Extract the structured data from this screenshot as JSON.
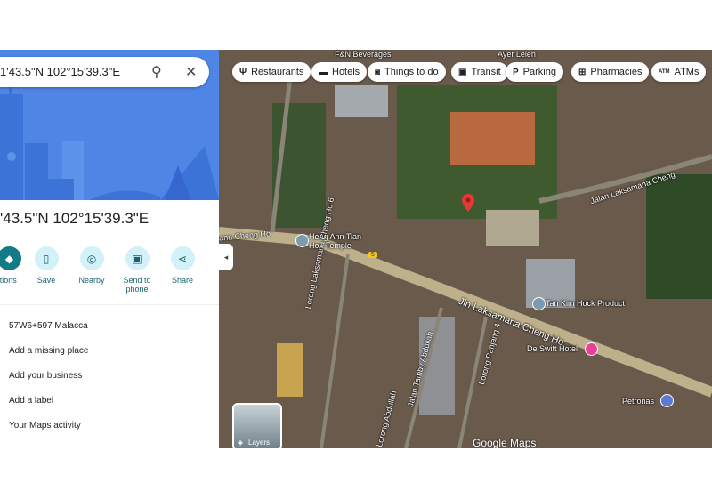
{
  "sidebar": {
    "search_value": "1'43.5\"N 102°15'39.3\"E",
    "title": "'43.5\"N 102°15'39.3\"E",
    "actions": [
      {
        "label": "ctions",
        "icon": "directions-icon"
      },
      {
        "label": "Save",
        "icon": "bookmark-icon"
      },
      {
        "label": "Nearby",
        "icon": "nearby-icon"
      },
      {
        "label": "Send to phone",
        "icon": "send-to-phone-icon"
      },
      {
        "label": "Share",
        "icon": "share-icon"
      }
    ],
    "items": [
      "57W6+597 Malacca",
      "Add a missing place",
      "Add your business",
      "Add a label",
      "Your Maps activity"
    ]
  },
  "map": {
    "chips": [
      {
        "label": "Restaurants",
        "icon": "restaurant-icon"
      },
      {
        "label": "Hotels",
        "icon": "hotel-icon"
      },
      {
        "label": "Things to do",
        "icon": "camera-icon"
      },
      {
        "label": "Transit",
        "icon": "transit-icon"
      },
      {
        "label": "Parking",
        "icon": "parking-icon"
      },
      {
        "label": "Pharmacies",
        "icon": "pharmacy-icon"
      },
      {
        "label": "ATMs",
        "icon": "atm-icon"
      }
    ],
    "labels": {
      "fn": "F&N Beverages",
      "ayer": "Ayer Leleh",
      "jalan_top": "Jalan Laksamana Cheng",
      "road_left": "ana Cheng Ho",
      "temple": "Heng Ann Tian Hou Temple",
      "jln_main": "Jln Laksamana Cheng Ho",
      "lorong6": "Lorong Laksamana Cheng Ho 6",
      "tamby": "Jalan Tamby Abdullah",
      "panjang": "Lorong Panjang 4",
      "abdullah": "Lorong Abdullah",
      "tankim": "Tan Kim Hock Product",
      "swift": "De Swift Hotel",
      "petronas": "Petronas",
      "route": "5"
    },
    "layers_label": "Layers",
    "brand": "Google Maps",
    "pin_color": "#e53935"
  }
}
